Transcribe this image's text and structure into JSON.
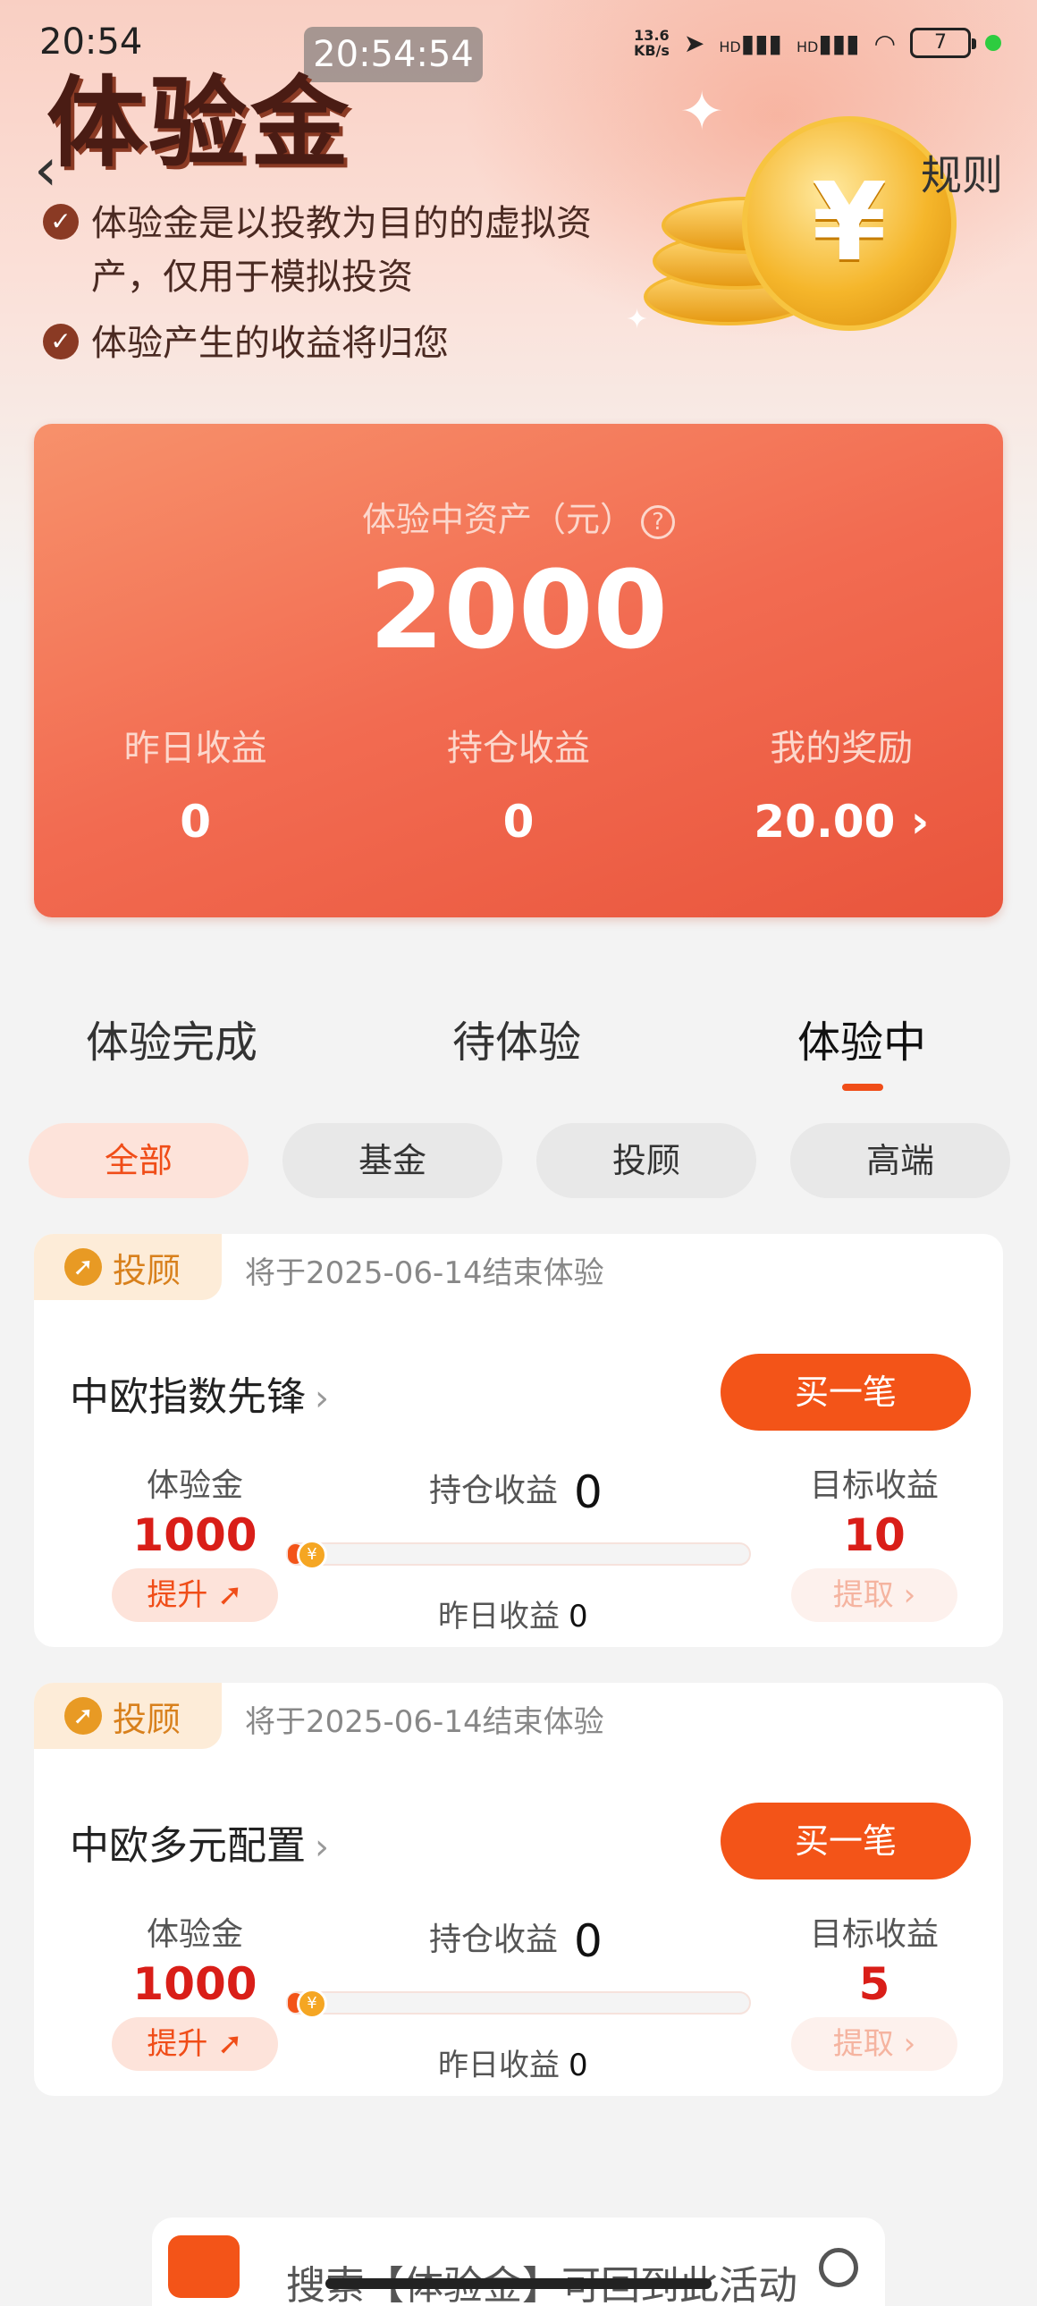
{
  "status_bar": {
    "time": "20:54",
    "center_time": "20:54:54",
    "net_speed_value": "13.6",
    "net_speed_unit": "KB/s",
    "signal_1": "HD",
    "signal_2": "HD",
    "battery": "7"
  },
  "header": {
    "title": "体验金",
    "rules_label": "规则",
    "bullets": [
      "体验金是以投教为目的的虚拟资产，仅用于模拟投资",
      "体验产生的收益将归您"
    ],
    "coin_symbol": "¥"
  },
  "asset_card": {
    "label": "体验中资产（元）",
    "help_symbol": "?",
    "value": "2000",
    "stats": [
      {
        "label": "昨日收益",
        "value": "0"
      },
      {
        "label": "持仓收益",
        "value": "0"
      },
      {
        "label": "我的奖励",
        "value": "20.00 ›"
      }
    ]
  },
  "tabs": [
    {
      "label": "体验完成",
      "active": false
    },
    {
      "label": "待体验",
      "active": false
    },
    {
      "label": "体验中",
      "active": true
    }
  ],
  "filters": [
    {
      "label": "全部",
      "active": true
    },
    {
      "label": "基金",
      "active": false
    },
    {
      "label": "投顾",
      "active": false
    },
    {
      "label": "高端",
      "active": false
    }
  ],
  "funds": [
    {
      "tag": "投顾",
      "end_text": "将于2025-06-14结束体验",
      "name": "中欧指数先锋",
      "buy_label": "买一笔",
      "experience_label": "体验金",
      "experience_value": "1000",
      "upgrade_label": "提升 ➚",
      "hold_label": "持仓收益",
      "hold_value": "0",
      "yesterday_label": "昨日收益",
      "yesterday_value": "0",
      "target_label": "目标收益",
      "target_value": "10",
      "withdraw_label": "提取 ›",
      "progress": 0.0
    },
    {
      "tag": "投顾",
      "end_text": "将于2025-06-14结束体验",
      "name": "中欧多元配置",
      "buy_label": "买一笔",
      "experience_label": "体验金",
      "experience_value": "1000",
      "upgrade_label": "提升 ➚",
      "hold_label": "持仓收益",
      "hold_value": "0",
      "yesterday_label": "昨日收益",
      "yesterday_value": "0",
      "target_label": "目标收益",
      "target_value": "5",
      "withdraw_label": "提取 ›",
      "progress": 0.0
    }
  ],
  "bottom_bar": {
    "text": "搜索【体验金】可回到此活动"
  },
  "colors": {
    "accent": "#f35418",
    "card_gradient_start": "#f7916b",
    "card_gradient_end": "#e9553c",
    "target_red": "#d91e18"
  },
  "icons": {
    "back": "chevron-left-icon",
    "check": "check-circle-icon",
    "help": "question-circle-icon",
    "tag": "advisor-icon",
    "chevron": "chevron-right-icon",
    "search": "search-icon"
  }
}
